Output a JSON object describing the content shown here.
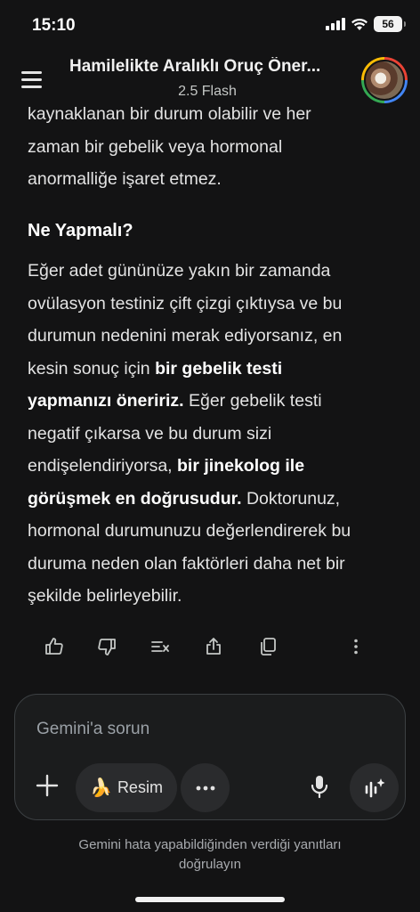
{
  "status": {
    "time": "15:10",
    "battery": "56"
  },
  "header": {
    "title": "Hamilelikte Aralıklı Oruç Öner...",
    "model": "2.5 Flash"
  },
  "content": {
    "prev_lines": [
      "kaynaklanan bir durum olabilir ve her",
      "zaman bir gebelik veya hormonal",
      "anormalliğe işaret etmez."
    ],
    "heading": "Ne Yapmalı?",
    "lines": [
      {
        "a": "Eğer adet gününüze yakın bir zamanda",
        "b": "",
        "c": ""
      },
      {
        "a": "ovülasyon testiniz çift çizgi çıktıysa ve bu",
        "b": "",
        "c": ""
      },
      {
        "a": "durumun nedenini merak ediyorsanız, en",
        "b": "",
        "c": ""
      },
      {
        "a": "kesin sonuç için ",
        "b": "bir gebelik testi",
        "c": ""
      },
      {
        "a": "",
        "b": "yapmanızı öneririz.",
        "c": " Eğer gebelik testi"
      },
      {
        "a": "negatif çıkarsa ve bu durum sizi",
        "b": "",
        "c": ""
      },
      {
        "a": "endişelendiriyorsa, ",
        "b": "bir jinekolog ile",
        "c": ""
      },
      {
        "a": "",
        "b": "görüşmek en doğrusudur.",
        "c": " Doktorunuz,"
      },
      {
        "a": "hormonal durumunuzu değerlendirerek bu",
        "b": "",
        "c": ""
      },
      {
        "a": "duruma neden olan faktörleri daha net bir",
        "b": "",
        "c": ""
      },
      {
        "a": "şekilde belirleyebilir.",
        "b": "",
        "c": ""
      }
    ]
  },
  "actions": [
    "thumbs-up-icon",
    "thumbs-down-icon",
    "modify-response-icon",
    "share-icon",
    "copy-icon",
    "more-vert-icon"
  ],
  "input": {
    "placeholder": "Gemini'a sorun",
    "image_label": "Resim",
    "image_emoji": "🍌"
  },
  "disclaimer": {
    "line1": "Gemini hata yapabildiğinden verdiği yanıtları",
    "line2": "doğrulayın"
  },
  "colors": {
    "background": "#131314",
    "text": "#e3e3e3",
    "input_bg": "#1b1c1d",
    "pill_bg": "#2a2b2d"
  }
}
